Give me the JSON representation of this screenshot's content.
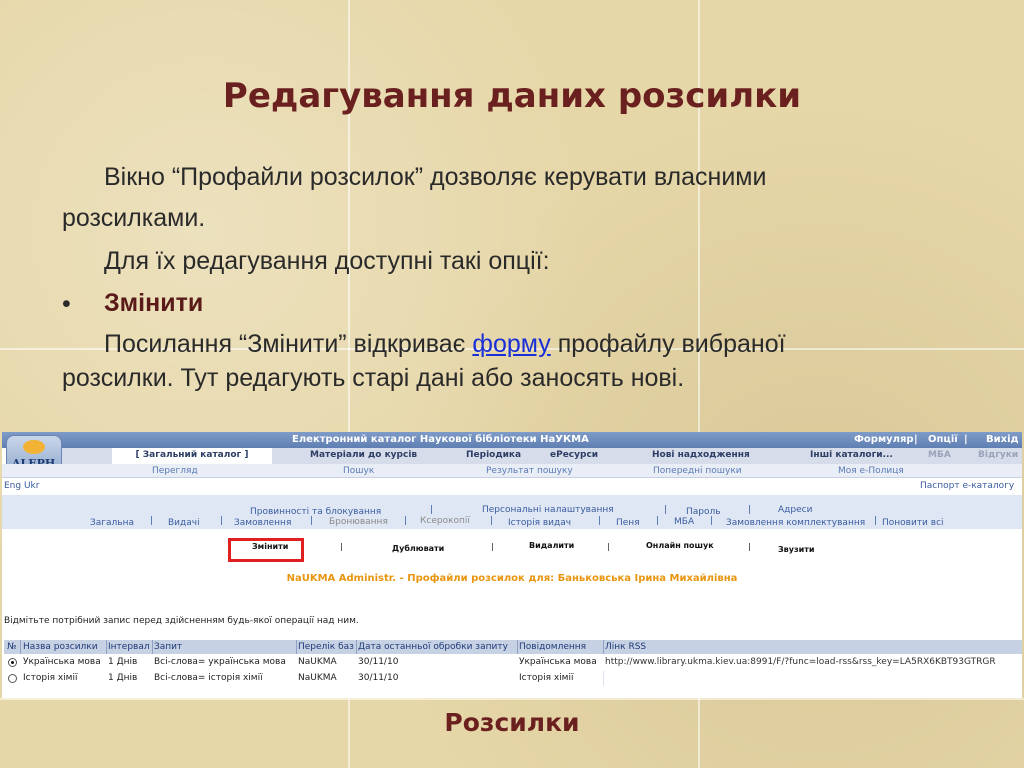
{
  "slide": {
    "title": "Редагування даних розсилки",
    "p1_line1": "Вікно “Профайли розсилок” дозволяє керувати власними",
    "p1_line2": "розсилками.",
    "p2": "Для їх редагування доступні такі опції:",
    "bullet": "•",
    "bullet_item": "Змінити",
    "p3_before": "Посилання “Змінити” відкриває ",
    "p3_link": "форму",
    "p3_after": " профайлу вибраної",
    "p3_line2": "розсилки. Тут редагують старі дані або заносять нові.",
    "caption": "Розсилки"
  },
  "screenshot": {
    "logo_text": "ALEPH",
    "top_title": "Електронний каталог Наукової бібліотеки НаУКМА",
    "top_links": [
      "Формуляр",
      "Опції",
      "Вихід"
    ],
    "top_seps": [
      "|",
      "|"
    ],
    "nav_tabs": [
      "[ Загальний каталог ]",
      "Матеріали до курсів",
      "Періодика",
      "еРесурси",
      "Нові надходження",
      "Інші каталоги...",
      "МБА",
      "Відгуки"
    ],
    "sub_tabs": [
      "Перегляд",
      "Пошук",
      "Результат пошуку",
      "Попередні пошуки",
      "Моя е-Полиця"
    ],
    "lang": "Eng Ukr",
    "passport": "Паспорт е-каталогу",
    "acct_row1": [
      "Провинності та блокування",
      "Персональні налаштування",
      "Пароль",
      "Адреси"
    ],
    "acct_row2": [
      "Загальна",
      "Видачі",
      "Замовлення",
      "Бронювання",
      "Ксерокопії",
      "Історія видач",
      "Пеня",
      "МБА",
      "Замовлення комплектування",
      "Поновити всі"
    ],
    "acct_sep": "|",
    "actions": [
      "Змінити",
      "Дублювати",
      "Видалити",
      "Онлайн пошук",
      "Звузити"
    ],
    "profile_title": "NaUKMA Administr. - Профайли розсилок для: Баньковська Ірина Михайлівна",
    "hint": "Відмітьте потрібний запис перед здійсненням будь-якої операції над ним.",
    "table": {
      "headers": [
        "№",
        "Назва розсилки",
        "Інтервал",
        "Запит",
        "Перелік баз",
        "Дата останньої обробки запиту",
        "Повідомлення",
        "Лінк RSS"
      ],
      "rows": [
        {
          "checked": true,
          "name": "Українська мова",
          "interval": "1 Днів",
          "query": "Всі-слова= українська мова",
          "bases": "NaUKMA",
          "date": "30/11/10",
          "message": "Українська мова",
          "rss": "http://www.library.ukma.kiev.ua:8991/F/?func=load-rss&rss_key=LA5RX6KBT93GTRGR"
        },
        {
          "checked": false,
          "name": "Історія хімії",
          "interval": "1 Днів",
          "query": "Всі-слова= історія хімії",
          "bases": "NaUKMA",
          "date": "30/11/10",
          "message": "Історія хімії",
          "rss": ""
        }
      ]
    }
  }
}
